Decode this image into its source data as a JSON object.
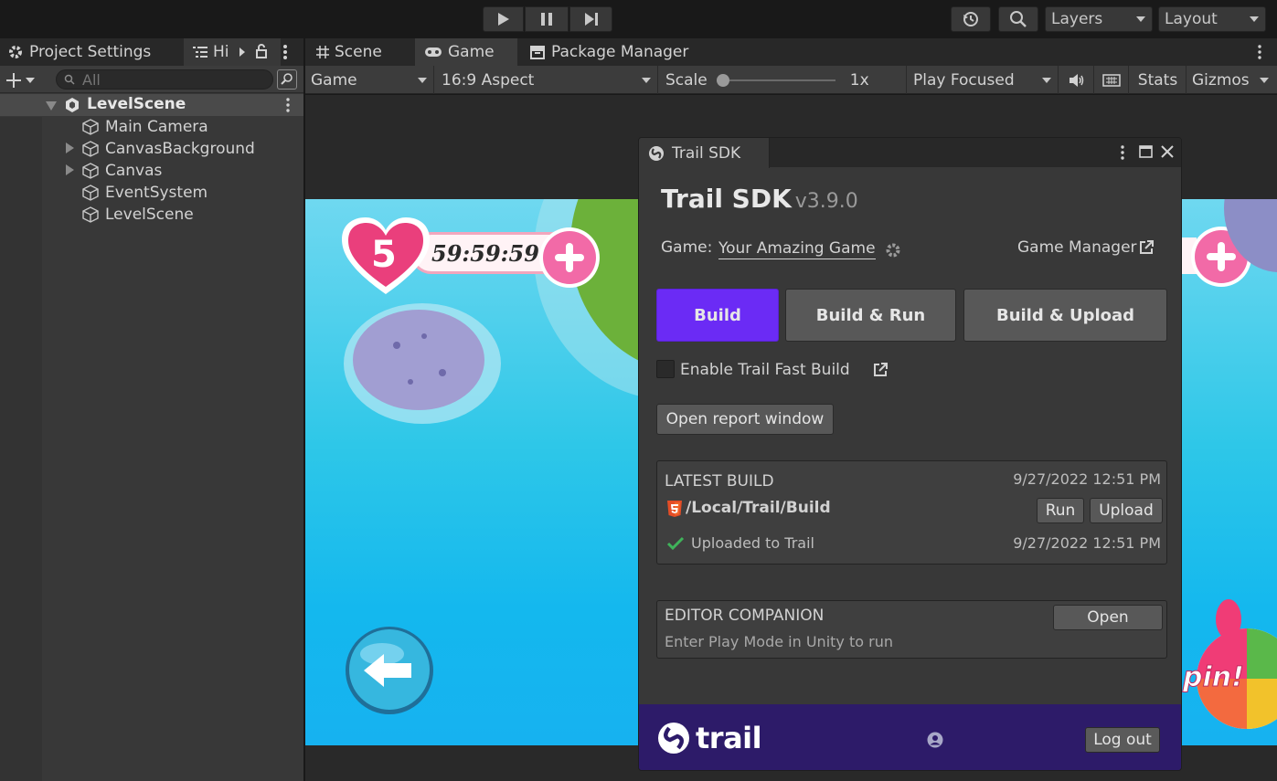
{
  "toolbar": {
    "layers_label": "Layers",
    "layout_label": "Layout"
  },
  "left": {
    "tab_project_settings": "Project Settings",
    "tab_hierarchy": "Hi",
    "search_placeholder": "All",
    "scene_name": "LevelScene",
    "items": [
      {
        "label": "Main Camera"
      },
      {
        "label": "CanvasBackground"
      },
      {
        "label": "Canvas"
      },
      {
        "label": "EventSystem"
      },
      {
        "label": "LevelScene"
      }
    ]
  },
  "main": {
    "tab_scene": "Scene",
    "tab_game": "Game",
    "tab_package_manager": "Package Manager",
    "display_dropdown": "Game",
    "aspect_dropdown": "16:9 Aspect",
    "scale_label": "Scale",
    "scale_value": "1x",
    "play_mode_dropdown": "Play Focused",
    "stats_label": "Stats",
    "gizmos_label": "Gizmos"
  },
  "game": {
    "lives": "5",
    "timer": "59:59:59"
  },
  "sdk": {
    "tab_title": "Trail SDK",
    "title": "Trail SDK",
    "version": "v3.9.0",
    "game_label": "Game:",
    "game_name": "Your Amazing Game",
    "game_manager_link": "Game Manager",
    "build_btn": "Build",
    "build_run_btn": "Build & Run",
    "build_upload_btn": "Build & Upload",
    "fast_build_label": "Enable Trail Fast Build",
    "open_report_btn": "Open report window",
    "latest_build": {
      "heading": "LATEST BUILD",
      "timestamp": "9/27/2022 12:51 PM",
      "path": "/Local/Trail/Build",
      "run_btn": "Run",
      "upload_btn": "Upload",
      "status": "Uploaded to Trail",
      "status_timestamp": "9/27/2022 12:51 PM"
    },
    "companion": {
      "heading": "EDITOR COMPANION",
      "open_btn": "Open",
      "hint": "Enter Play Mode in Unity to run"
    },
    "footer": {
      "brand": "trail",
      "logout_btn": "Log out"
    },
    "colors": {
      "accent": "#6b2bf5",
      "footer_bg": "#2d1b69"
    }
  }
}
